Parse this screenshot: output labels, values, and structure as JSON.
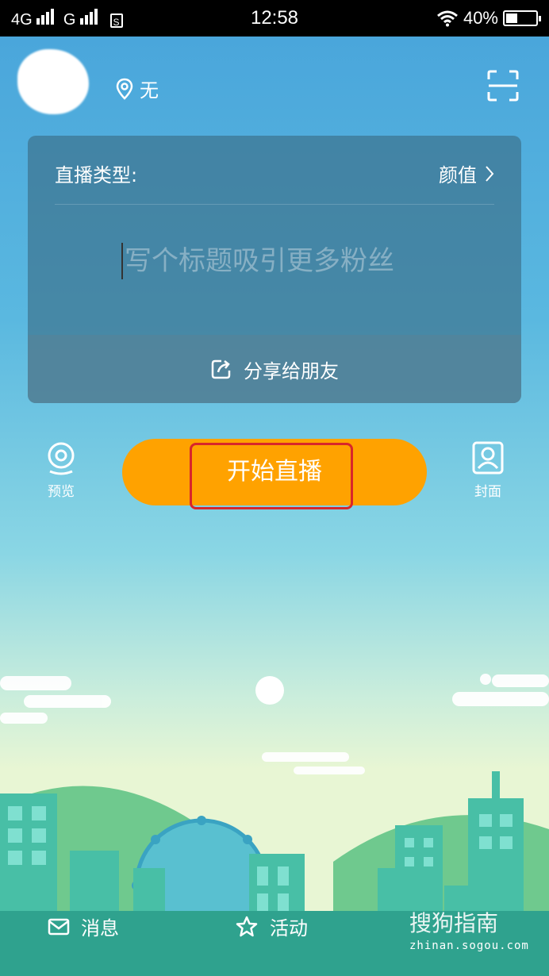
{
  "status": {
    "network": "4G",
    "network2": "G",
    "time": "12:58",
    "battery": "40%"
  },
  "header": {
    "location": "无"
  },
  "panel": {
    "type_label": "直播类型:",
    "type_value": "颜值",
    "title_placeholder": "写个标题吸引更多粉丝",
    "share": "分享给朋友"
  },
  "actions": {
    "preview": "预览",
    "start": "开始直播",
    "cover": "封面"
  },
  "nav": {
    "messages": "消息",
    "activity": "活动"
  },
  "watermark": {
    "brand": "搜狗指南",
    "url": "zhinan.sogou.com"
  },
  "colors": {
    "accent": "#ffa200",
    "highlight": "#d8262b"
  }
}
